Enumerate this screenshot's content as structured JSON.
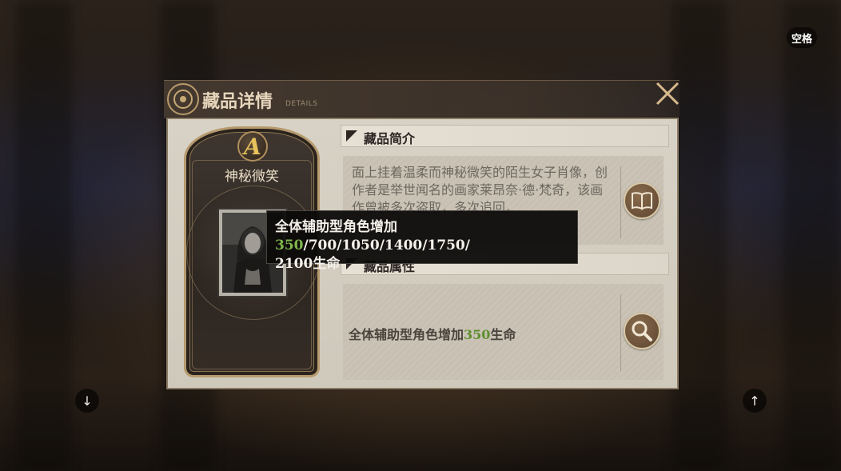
{
  "hud": {
    "space_key": "空格",
    "prev_arrow": "↓",
    "next_arrow": "↑"
  },
  "dialog": {
    "title": "藏品详情",
    "subtitle": "DETAILS"
  },
  "item": {
    "rank": "A",
    "name": "神秘微笑"
  },
  "sections": {
    "intro_label": "藏品简介",
    "intro_text": "面上挂着温柔而神秘微笑的陌生女子肖像，创作者是举世闻名的画家莱昂奈·德·梵奇，该画作曾被多次盗取，多次追回，",
    "attr_label": "藏品属性",
    "attr_prefix": "全体辅助型角色增加",
    "attr_value": "350",
    "attr_suffix": "生命"
  },
  "tooltip": {
    "prefix": "全体辅助型角色增加",
    "first_value": "350",
    "rest_values": "/700/1050/1400/1750/",
    "line2": "2100生命"
  },
  "colors": {
    "accent_green": "#5e8f2e",
    "tooltip_green": "#7fb84a",
    "gold": "#e8c25a"
  },
  "icons": {
    "book": "book-icon",
    "search": "search-icon",
    "close": "close-icon",
    "emblem": "emblem-icon"
  }
}
